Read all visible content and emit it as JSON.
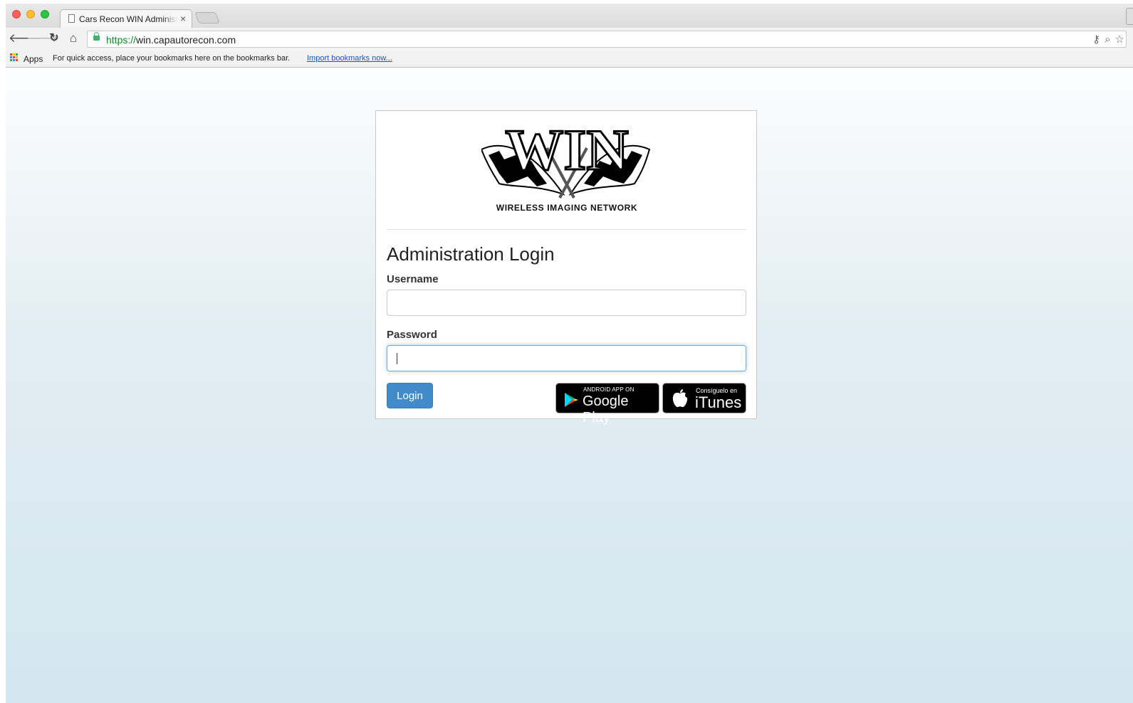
{
  "browser": {
    "tab_title": "Cars Recon WIN Administration",
    "tab_close": "×",
    "url_scheme": "https://",
    "url_host": "win.capautorecon.com",
    "bookmarks": {
      "apps_label": "Apps",
      "hint_text": "For quick access, place your bookmarks here on the bookmarks bar.",
      "import_link": "Import bookmarks now..."
    }
  },
  "login_card": {
    "logo_text": "WIN",
    "logo_caption": "WIRELESS IMAGING NETWORK",
    "heading": "Administration Login",
    "username_label": "Username",
    "username_value": "",
    "password_label": "Password",
    "password_value": "",
    "login_button": "Login",
    "google_play": {
      "small_text": "ANDROID APP ON",
      "big_text": "Google Play"
    },
    "itunes": {
      "small_text": "Consíguelo en",
      "big_text": "iTunes"
    }
  },
  "colors": {
    "primary_button": "#428bca",
    "focus_border": "#66afe9"
  }
}
